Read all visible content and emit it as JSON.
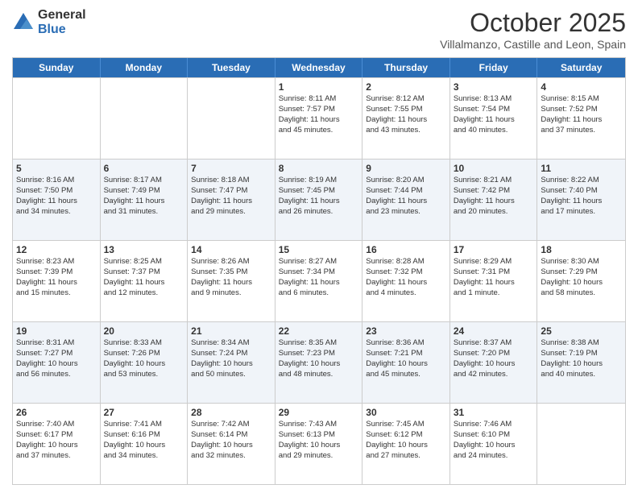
{
  "logo": {
    "general": "General",
    "blue": "Blue"
  },
  "title": "October 2025",
  "subtitle": "Villalmanzo, Castille and Leon, Spain",
  "headers": [
    "Sunday",
    "Monday",
    "Tuesday",
    "Wednesday",
    "Thursday",
    "Friday",
    "Saturday"
  ],
  "rows": [
    [
      {
        "day": "",
        "lines": []
      },
      {
        "day": "",
        "lines": []
      },
      {
        "day": "",
        "lines": []
      },
      {
        "day": "1",
        "lines": [
          "Sunrise: 8:11 AM",
          "Sunset: 7:57 PM",
          "Daylight: 11 hours",
          "and 45 minutes."
        ]
      },
      {
        "day": "2",
        "lines": [
          "Sunrise: 8:12 AM",
          "Sunset: 7:55 PM",
          "Daylight: 11 hours",
          "and 43 minutes."
        ]
      },
      {
        "day": "3",
        "lines": [
          "Sunrise: 8:13 AM",
          "Sunset: 7:54 PM",
          "Daylight: 11 hours",
          "and 40 minutes."
        ]
      },
      {
        "day": "4",
        "lines": [
          "Sunrise: 8:15 AM",
          "Sunset: 7:52 PM",
          "Daylight: 11 hours",
          "and 37 minutes."
        ]
      }
    ],
    [
      {
        "day": "5",
        "lines": [
          "Sunrise: 8:16 AM",
          "Sunset: 7:50 PM",
          "Daylight: 11 hours",
          "and 34 minutes."
        ]
      },
      {
        "day": "6",
        "lines": [
          "Sunrise: 8:17 AM",
          "Sunset: 7:49 PM",
          "Daylight: 11 hours",
          "and 31 minutes."
        ]
      },
      {
        "day": "7",
        "lines": [
          "Sunrise: 8:18 AM",
          "Sunset: 7:47 PM",
          "Daylight: 11 hours",
          "and 29 minutes."
        ]
      },
      {
        "day": "8",
        "lines": [
          "Sunrise: 8:19 AM",
          "Sunset: 7:45 PM",
          "Daylight: 11 hours",
          "and 26 minutes."
        ]
      },
      {
        "day": "9",
        "lines": [
          "Sunrise: 8:20 AM",
          "Sunset: 7:44 PM",
          "Daylight: 11 hours",
          "and 23 minutes."
        ]
      },
      {
        "day": "10",
        "lines": [
          "Sunrise: 8:21 AM",
          "Sunset: 7:42 PM",
          "Daylight: 11 hours",
          "and 20 minutes."
        ]
      },
      {
        "day": "11",
        "lines": [
          "Sunrise: 8:22 AM",
          "Sunset: 7:40 PM",
          "Daylight: 11 hours",
          "and 17 minutes."
        ]
      }
    ],
    [
      {
        "day": "12",
        "lines": [
          "Sunrise: 8:23 AM",
          "Sunset: 7:39 PM",
          "Daylight: 11 hours",
          "and 15 minutes."
        ]
      },
      {
        "day": "13",
        "lines": [
          "Sunrise: 8:25 AM",
          "Sunset: 7:37 PM",
          "Daylight: 11 hours",
          "and 12 minutes."
        ]
      },
      {
        "day": "14",
        "lines": [
          "Sunrise: 8:26 AM",
          "Sunset: 7:35 PM",
          "Daylight: 11 hours",
          "and 9 minutes."
        ]
      },
      {
        "day": "15",
        "lines": [
          "Sunrise: 8:27 AM",
          "Sunset: 7:34 PM",
          "Daylight: 11 hours",
          "and 6 minutes."
        ]
      },
      {
        "day": "16",
        "lines": [
          "Sunrise: 8:28 AM",
          "Sunset: 7:32 PM",
          "Daylight: 11 hours",
          "and 4 minutes."
        ]
      },
      {
        "day": "17",
        "lines": [
          "Sunrise: 8:29 AM",
          "Sunset: 7:31 PM",
          "Daylight: 11 hours",
          "and 1 minute."
        ]
      },
      {
        "day": "18",
        "lines": [
          "Sunrise: 8:30 AM",
          "Sunset: 7:29 PM",
          "Daylight: 10 hours",
          "and 58 minutes."
        ]
      }
    ],
    [
      {
        "day": "19",
        "lines": [
          "Sunrise: 8:31 AM",
          "Sunset: 7:27 PM",
          "Daylight: 10 hours",
          "and 56 minutes."
        ]
      },
      {
        "day": "20",
        "lines": [
          "Sunrise: 8:33 AM",
          "Sunset: 7:26 PM",
          "Daylight: 10 hours",
          "and 53 minutes."
        ]
      },
      {
        "day": "21",
        "lines": [
          "Sunrise: 8:34 AM",
          "Sunset: 7:24 PM",
          "Daylight: 10 hours",
          "and 50 minutes."
        ]
      },
      {
        "day": "22",
        "lines": [
          "Sunrise: 8:35 AM",
          "Sunset: 7:23 PM",
          "Daylight: 10 hours",
          "and 48 minutes."
        ]
      },
      {
        "day": "23",
        "lines": [
          "Sunrise: 8:36 AM",
          "Sunset: 7:21 PM",
          "Daylight: 10 hours",
          "and 45 minutes."
        ]
      },
      {
        "day": "24",
        "lines": [
          "Sunrise: 8:37 AM",
          "Sunset: 7:20 PM",
          "Daylight: 10 hours",
          "and 42 minutes."
        ]
      },
      {
        "day": "25",
        "lines": [
          "Sunrise: 8:38 AM",
          "Sunset: 7:19 PM",
          "Daylight: 10 hours",
          "and 40 minutes."
        ]
      }
    ],
    [
      {
        "day": "26",
        "lines": [
          "Sunrise: 7:40 AM",
          "Sunset: 6:17 PM",
          "Daylight: 10 hours",
          "and 37 minutes."
        ]
      },
      {
        "day": "27",
        "lines": [
          "Sunrise: 7:41 AM",
          "Sunset: 6:16 PM",
          "Daylight: 10 hours",
          "and 34 minutes."
        ]
      },
      {
        "day": "28",
        "lines": [
          "Sunrise: 7:42 AM",
          "Sunset: 6:14 PM",
          "Daylight: 10 hours",
          "and 32 minutes."
        ]
      },
      {
        "day": "29",
        "lines": [
          "Sunrise: 7:43 AM",
          "Sunset: 6:13 PM",
          "Daylight: 10 hours",
          "and 29 minutes."
        ]
      },
      {
        "day": "30",
        "lines": [
          "Sunrise: 7:45 AM",
          "Sunset: 6:12 PM",
          "Daylight: 10 hours",
          "and 27 minutes."
        ]
      },
      {
        "day": "31",
        "lines": [
          "Sunrise: 7:46 AM",
          "Sunset: 6:10 PM",
          "Daylight: 10 hours",
          "and 24 minutes."
        ]
      },
      {
        "day": "",
        "lines": []
      }
    ]
  ]
}
